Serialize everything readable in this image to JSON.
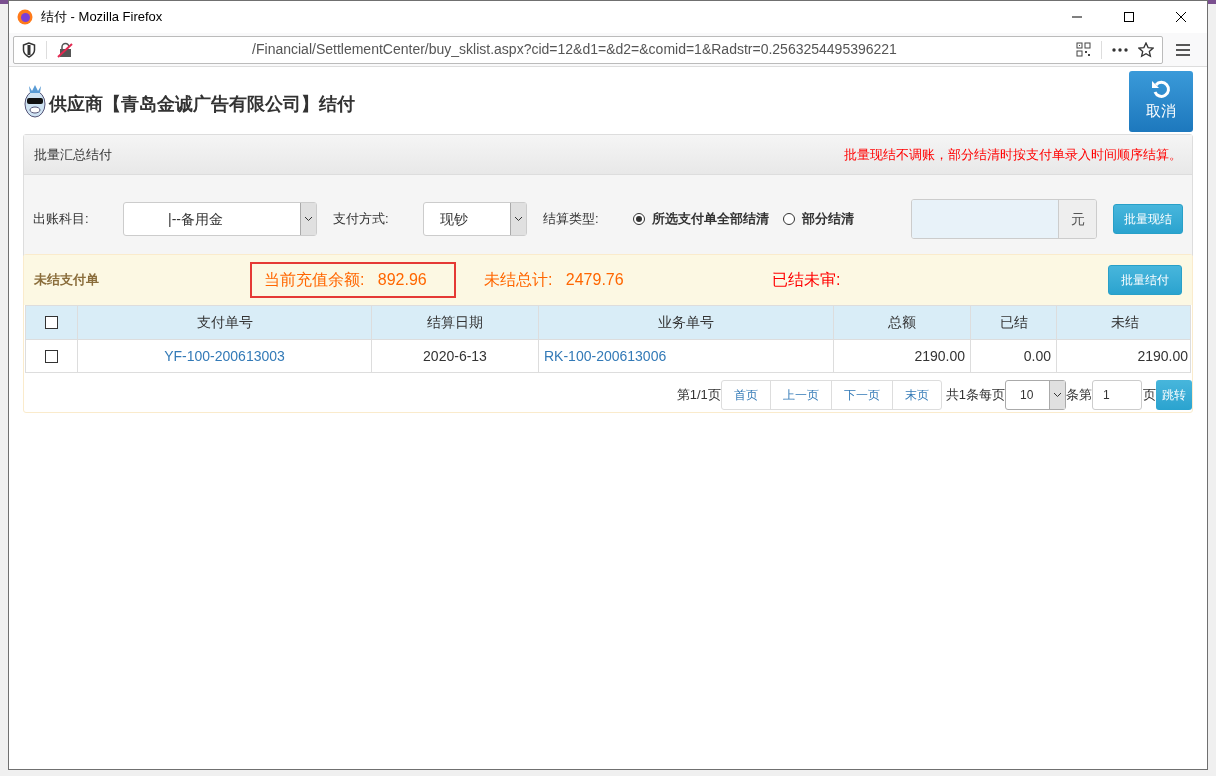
{
  "window": {
    "title": "结付 - Mozilla Firefox"
  },
  "address_bar": {
    "url": "/Financial/SettlementCenter/buy_sklist.aspx?cid=12&d1=&d2=&comid=1&Radstr=0.2563254495396221"
  },
  "page": {
    "title": "供应商【青岛金诚广告有限公司】结付",
    "cancel_button": "取消"
  },
  "batch_panel": {
    "title": "批量汇总结付",
    "notice": "批量现结不调账，部分结清时按支付单录入时间顺序结算。",
    "account": {
      "label": "出账科目:",
      "value": "|--备用金"
    },
    "payment_method": {
      "label": "支付方式:",
      "value": "现钞"
    },
    "settle_type": {
      "label": "结算类型:",
      "options": [
        {
          "label": "所选支付单全部结清",
          "selected": true
        },
        {
          "label": "部分结清",
          "selected": false
        }
      ]
    },
    "amount": {
      "unit": "元"
    },
    "button": "批量现结"
  },
  "unpaid_panel": {
    "title": "未结支付单",
    "stats": [
      {
        "kind": "boxed",
        "label": "当前充值余额:",
        "value": "892.96"
      },
      {
        "kind": "plain",
        "label": "未结总计:",
        "value": "2479.76"
      },
      {
        "kind": "alert",
        "label": "已结未审:"
      }
    ],
    "button": "批量结付",
    "table": {
      "columns": [
        "支付单号",
        "结算日期",
        "业务单号",
        "总额",
        "已结",
        "未结"
      ],
      "all_checked": false,
      "rows": [
        {
          "checked": false,
          "cells": [
            "YF-100-200613003",
            "2020-6-13",
            "RK-100-200613006",
            "2190.00",
            "0.00",
            "2190.00"
          ]
        }
      ]
    },
    "pagination": {
      "page_info": "第1/1页",
      "links": [
        "首页",
        "上一页",
        "下一页",
        "末页"
      ],
      "total_per_page": "共1条每页",
      "page_size": "10",
      "item_page": "条第",
      "page_number": "1",
      "page_suffix": "页",
      "go_button": "跳转"
    }
  }
}
